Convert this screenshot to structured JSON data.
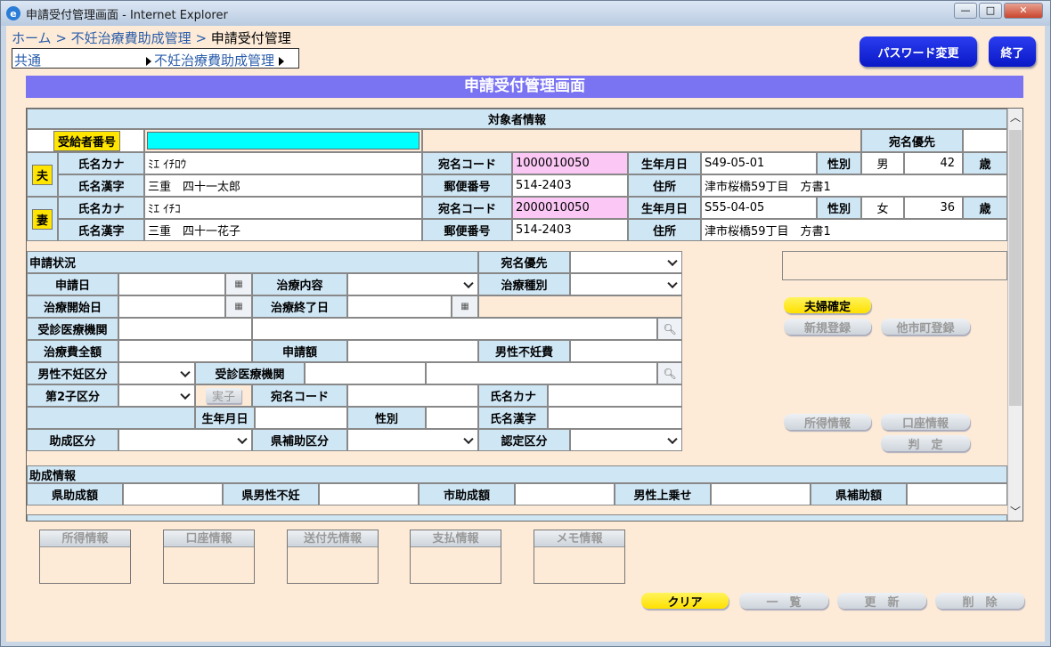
{
  "window": {
    "title": "申請受付管理画面 - Internet Explorer",
    "ie_icon": "ie-logo-icon",
    "controls": [
      "—",
      "□",
      "✕"
    ]
  },
  "breadcrumb": {
    "home": "ホーム",
    "sep1": " > ",
    "mid": "不妊治療費助成管理",
    "sep2": " > ",
    "cur": "申請受付管理"
  },
  "menu": {
    "common": "共通",
    "sub": "不妊治療費助成管理"
  },
  "buttons": {
    "password": "パスワード変更",
    "exit": "終了",
    "fufu": "夫婦確定",
    "new_reg": "新規登録",
    "other_city": "他市町登録",
    "income": "所得情報",
    "account": "口座情報",
    "judge": "判　定",
    "clear": "クリア",
    "list": "一　覧",
    "update": "更　新",
    "delete": "削　除"
  },
  "page_title": "申請受付管理画面",
  "subject": {
    "header": "対象者情報",
    "recipient_label": "受給者番号",
    "recipient_value": "",
    "atena_yusen": "宛名優先",
    "atena_yusen_value": ""
  },
  "husband": {
    "mark": "夫",
    "kana_label": "氏名カナ",
    "kana": "ﾐｴ ｲﾁﾛｳ",
    "code_label": "宛名コード",
    "code": "1000010050",
    "birth_label": "生年月日",
    "birth": "S49-05-01",
    "sex_label": "性別",
    "sex": "男",
    "age": "42",
    "age_unit": "歳",
    "kanji_label": "氏名漢字",
    "kanji": "三重　四十一太郎",
    "zip_label": "郵便番号",
    "zip": "514-2403",
    "addr_label": "住所",
    "addr": "津市桜橋59丁目　方書1"
  },
  "wife": {
    "mark": "妻",
    "kana_label": "氏名カナ",
    "kana": "ﾐｴ ｲﾁｺ",
    "code_label": "宛名コード",
    "code": "2000010050",
    "birth_label": "生年月日",
    "birth": "S55-04-05",
    "sex_label": "性別",
    "sex": "女",
    "age": "36",
    "age_unit": "歳",
    "kanji_label": "氏名漢字",
    "kanji": "三重　四十一花子",
    "zip_label": "郵便番号",
    "zip": "514-2403",
    "addr_label": "住所",
    "addr": "津市桜橋59丁目　方書1"
  },
  "app": {
    "section": "申請状況",
    "atena_yusen": "宛名優先",
    "apply_date": "申請日",
    "treat_content": "治療内容",
    "treat_type": "治療種別",
    "treat_start": "治療開始日",
    "treat_end": "治療終了日",
    "hospital": "受診医療機関",
    "total": "治療費全額",
    "apply_amount": "申請額",
    "male_cost": "男性不妊費",
    "male_cat": "男性不妊区分",
    "hospital2": "受診医療機関",
    "second_child": "第2子区分",
    "real_child": "実子",
    "atena_code": "宛名コード",
    "kana": "氏名カナ",
    "birth": "生年月日",
    "sex": "性別",
    "kanji": "氏名漢字",
    "grant_cat": "助成区分",
    "pref_cat": "県補助区分",
    "cert_cat": "認定区分"
  },
  "grant": {
    "section": "助成情報",
    "pref_grant": "県助成額",
    "pref_male": "県男性不妊",
    "city_grant": "市助成額",
    "male_extra": "男性上乗せ",
    "pref_sub": "県補助額"
  },
  "tabs": [
    "所得情報",
    "口座情報",
    "送付先情報",
    "支払情報",
    "メモ情報"
  ],
  "scroll": {
    "up": "︿",
    "down": "﹀"
  }
}
